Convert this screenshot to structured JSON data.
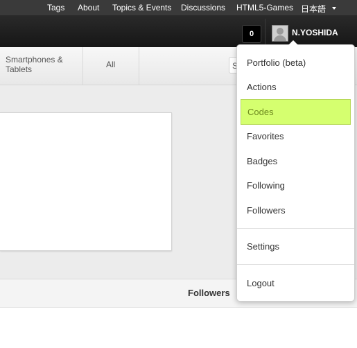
{
  "topnav": {
    "links": [
      "Tags",
      "About",
      "Topics & Events",
      "Discussions",
      "HTML5-Games",
      "日本語"
    ]
  },
  "header": {
    "notification_count": "0",
    "username": "N.YOSHIDA"
  },
  "subnav": {
    "tabs": [
      "Smartphones & Tablets",
      "All"
    ],
    "search_placeholder": "S"
  },
  "dropdown": {
    "items": [
      "Portfolio (beta)",
      "Actions",
      "Codes",
      "Favorites",
      "Badges",
      "Following",
      "Followers",
      "Settings",
      "Logout"
    ],
    "active_item": "Codes",
    "highlight_color": "#d5ff6f"
  },
  "main": {
    "followers_label": "Followers"
  }
}
